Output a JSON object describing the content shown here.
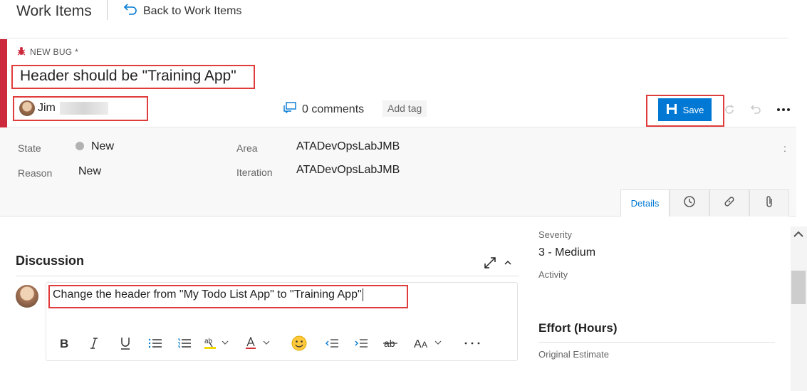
{
  "topbar": {
    "title": "Work Items",
    "back_label": "Back to Work Items"
  },
  "work_item": {
    "type_label": "NEW BUG *",
    "title": "Header should be \"Training App\"",
    "assignee": "Jim",
    "comments_label": "0 comments",
    "add_tag_label": "Add tag",
    "save_label": "Save"
  },
  "fields": {
    "state_label": "State",
    "state_value": "New",
    "reason_label": "Reason",
    "reason_value": "New",
    "area_label": "Area",
    "area_value": "ATADevOpsLabJMB",
    "iteration_label": "Iteration",
    "iteration_value": "ATADevOpsLabJMB",
    "kebab": ":"
  },
  "tabs": {
    "details_label": "Details"
  },
  "discussion": {
    "heading": "Discussion",
    "comment_text": "Change the header from \"My Todo List App\" to \"Training App\""
  },
  "right_panel": {
    "severity_label": "Severity",
    "severity_value": "3 - Medium",
    "activity_label": "Activity",
    "effort_heading": "Effort (Hours)",
    "original_estimate_label": "Original Estimate"
  },
  "colors": {
    "bug_red": "#cc293d",
    "primary_blue": "#0078d4",
    "highlight_red": "#e03c3c"
  }
}
